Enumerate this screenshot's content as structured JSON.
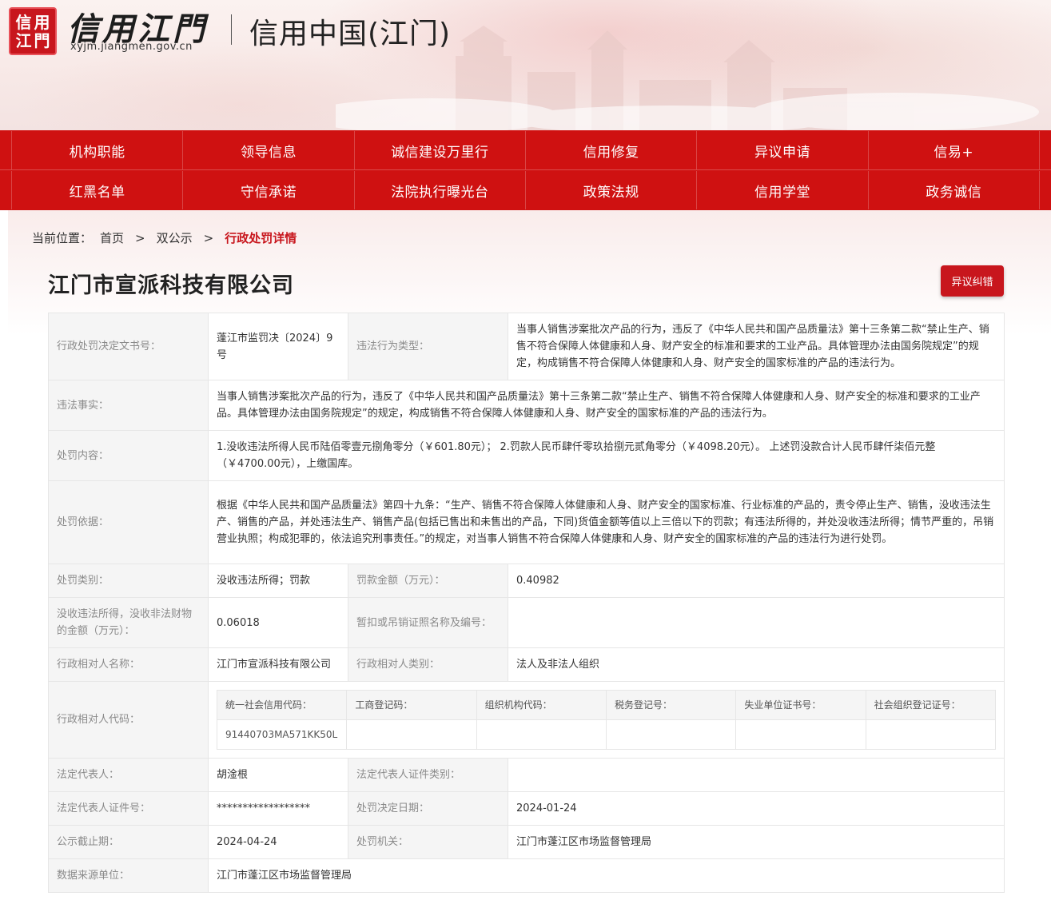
{
  "header": {
    "seal_chars": [
      "信",
      "用",
      "江",
      "門"
    ],
    "brand": "信用江門",
    "url": "xyjm.jiangmen.gov.cn",
    "site_title": "信用中国(江门)"
  },
  "nav": {
    "row1": [
      "机构职能",
      "领导信息",
      "诚信建设万里行",
      "信用修复",
      "异议申请",
      "信易+"
    ],
    "row2": [
      "红黑名单",
      "守信承诺",
      "法院执行曝光台",
      "政策法规",
      "信用学堂",
      "政务诚信"
    ]
  },
  "breadcrumb": {
    "label": "当前位置：",
    "home": "首页",
    "section": "双公示",
    "current": "行政处罚详情",
    "separator": ">"
  },
  "company": "江门市宣派科技有限公司",
  "objection_button": "异议纠错",
  "detail": {
    "decision_no_label": "行政处罚决定文书号：",
    "decision_no": "蓬江市监罚决〔2024〕9号",
    "violation_type_label": "违法行为类型：",
    "violation_type": "当事人销售涉案批次产品的行为，违反了《中华人民共和国产品质量法》第十三条第二款“禁止生产、销售不符合保障人体健康和人身、财产安全的标准和要求的工业产品。具体管理办法由国务院规定”的规定，构成销售不符合保障人体健康和人身、财产安全的国家标准的产品的违法行为。",
    "facts_label": "违法事实：",
    "facts": "当事人销售涉案批次产品的行为，违反了《中华人民共和国产品质量法》第十三条第二款“禁止生产、销售不符合保障人体健康和人身、财产安全的标准和要求的工业产品。具体管理办法由国务院规定”的规定，构成销售不符合保障人体健康和人身、财产安全的国家标准的产品的违法行为。",
    "content_label": "处罚内容：",
    "content": "1.没收违法所得人民币陆佰零壹元捌角零分（￥601.80元）； 2.罚款人民币肆仟零玖拾捌元贰角零分（￥4098.20元）。 上述罚没款合计人民币肆仟柒佰元整（￥4700.00元），上缴国库。",
    "basis_label": "处罚依据：",
    "basis": "根据《中华人民共和国产品质量法》第四十九条：“生产、销售不符合保障人体健康和人身、财产安全的国家标准、行业标准的产品的，责令停止生产、销售，没收违法生产、销售的产品，并处违法生产、销售产品(包括已售出和未售出的产品，下同)货值金额等值以上三倍以下的罚款；有违法所得的，并处没收违法所得；情节严重的，吊销营业执照；构成犯罪的，依法追究刑事责任。”的规定，对当事人销售不符合保障人体健康和人身、财产安全的国家标准的产品的违法行为进行处罚。",
    "category_label": "处罚类别：",
    "category": "没收违法所得；罚款",
    "fine_label": "罚款金额（万元）：",
    "fine": "0.40982",
    "confiscated_label": "没收违法所得，没收非法财物的金额（万元）：",
    "confiscated": "0.06018",
    "license_label": "暂扣或吊销证照名称及编号：",
    "license": "",
    "party_name_label": "行政相对人名称：",
    "party_name": "江门市宣派科技有限公司",
    "party_type_label": "行政相对人类别：",
    "party_type": "法人及非法人组织",
    "party_code_label": "行政相对人代码：",
    "codes": {
      "headers": [
        "统一社会信用代码：",
        "工商登记码：",
        "组织机构代码：",
        "税务登记号：",
        "失业单位证书号：",
        "社会组织登记证号："
      ],
      "values": [
        "91440703MA571KK50L",
        "",
        "",
        "",
        "",
        ""
      ]
    },
    "legal_rep_label": "法定代表人：",
    "legal_rep": "胡淦根",
    "legal_rep_id_type_label": "法定代表人证件类别：",
    "legal_rep_id_type": "",
    "legal_rep_id_no_label": "法定代表人证件号：",
    "legal_rep_id_no": "******************",
    "decision_date_label": "处罚决定日期：",
    "decision_date": "2024-01-24",
    "publish_deadline_label": "公示截止期：",
    "publish_deadline": "2024-04-24",
    "authority_label": "处罚机关：",
    "authority": "江门市蓬江区市场监督管理局",
    "source_label": "数据来源单位：",
    "source": "江门市蓬江区市场监督管理局"
  }
}
